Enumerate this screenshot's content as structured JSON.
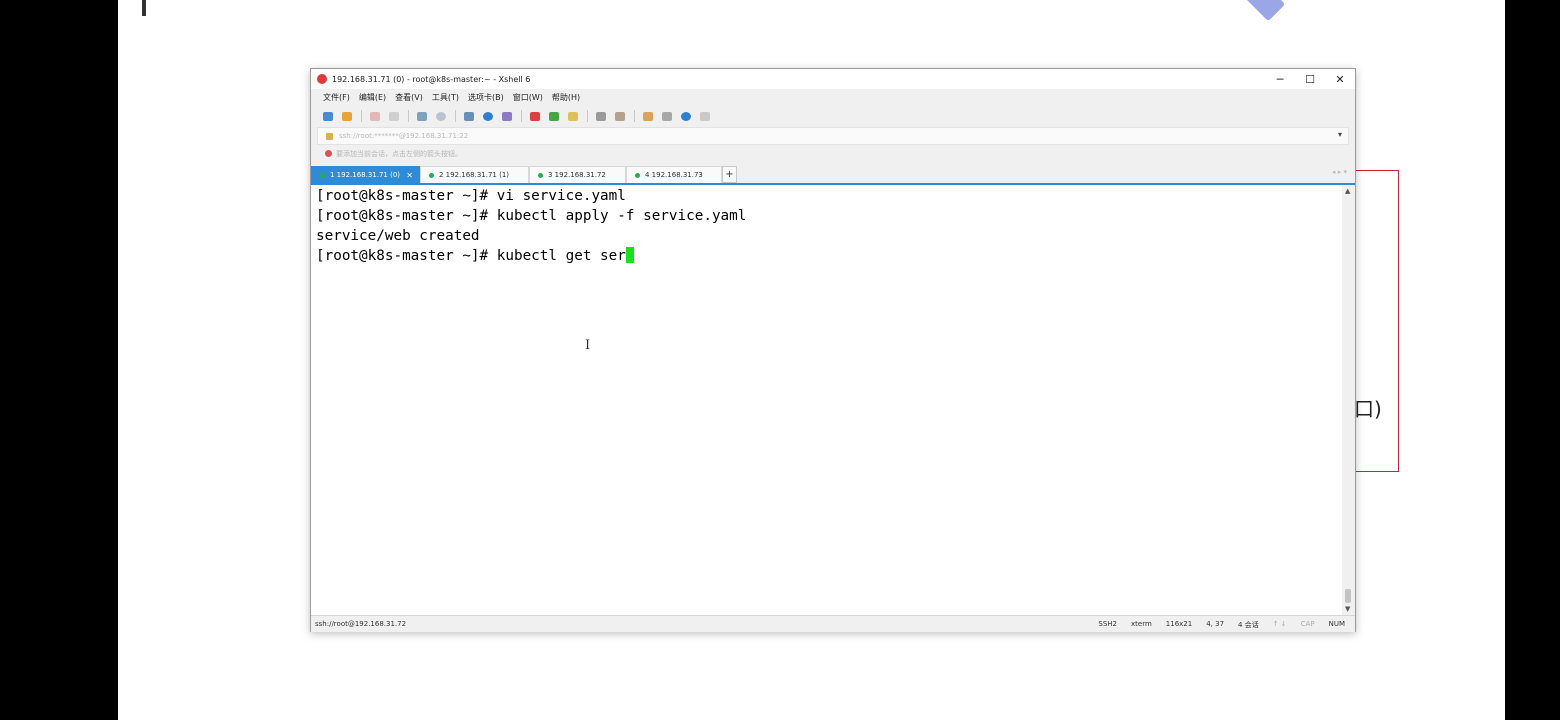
{
  "window": {
    "title": "192.168.31.71 (0) - root@k8s-master:~ - Xshell 6",
    "minimize": "─",
    "maximize": "☐",
    "close": "✕"
  },
  "menu": [
    "文件(F)",
    "编辑(E)",
    "查看(V)",
    "工具(T)",
    "选项卡(B)",
    "窗口(W)",
    "帮助(H)"
  ],
  "address_bar": {
    "text": "ssh://root:*******@192.168.31.71:22",
    "dropdown": "▾"
  },
  "tip_bar": {
    "text": "要添加当前会话，点击左侧的箭头按钮。"
  },
  "tabs": [
    {
      "label": "1 192.168.31.71 (0)",
      "active": true,
      "close": "✕"
    },
    {
      "label": "2 192.168.31.71 (1)",
      "active": false
    },
    {
      "label": "3 192.168.31.72",
      "active": false
    },
    {
      "label": "4 192.168.31.73",
      "active": false
    }
  ],
  "tab_add": "+",
  "tab_nav": "◂ ▸ ▾",
  "terminal": {
    "lines": [
      "[root@k8s-master ~]# vi service.yaml",
      "[root@k8s-master ~]# kubectl apply -f service.yaml",
      "service/web created",
      "[root@k8s-master ~]# kubectl get ser"
    ],
    "ibeam": "I",
    "cursor_color": "#19e01d"
  },
  "scrollbar": {
    "up": "▲",
    "down": "▼"
  },
  "status": {
    "left": "ssh://root@192.168.31.72",
    "protocol": "SSH2",
    "term": "xterm",
    "size": "116x21",
    "position": "4, 37",
    "sessions": "4 会话",
    "arrows": "↑ ↓",
    "caps": "CAP",
    "num": "NUM"
  },
  "slide": {
    "box_text": "口)"
  },
  "colors": {
    "tab_active": "#2e8bd8",
    "slide_box_border": "#c0283a"
  }
}
